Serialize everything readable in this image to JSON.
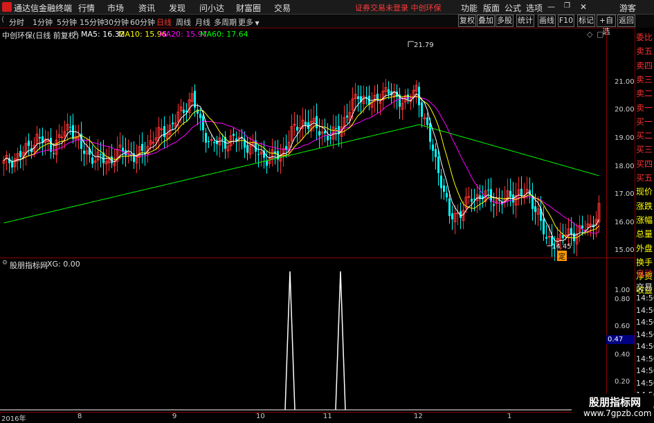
{
  "app": {
    "name": "通达信金融终端",
    "notice": "证券交易未登录",
    "stock_short": "中创环保"
  },
  "menu": [
    "行情",
    "市场",
    "资讯",
    "发现",
    "问小达",
    "财富圈",
    "交易"
  ],
  "right_menu": [
    "功能",
    "版面",
    "公式",
    "选项",
    "游客"
  ],
  "timeframes": [
    "分时",
    "1分钟",
    "5分钟",
    "15分钟",
    "30分钟",
    "60分钟",
    "日线",
    "周线",
    "月线",
    "多周期",
    "更多"
  ],
  "active_timeframe": "日线",
  "toolbar": [
    "复权",
    "叠加",
    "多股",
    "统计",
    "画线",
    "F10",
    "标记",
    "+自选",
    "返回"
  ],
  "legend": {
    "title": "中创环保(日线 前复权)",
    "ma5": "MA5: 16.32",
    "ma10": "MA10: 15.96",
    "ma20": "MA20: 15.97",
    "ma60": "MA60: 17.64"
  },
  "colors": {
    "ma5": "#ffffff",
    "ma10": "#ffff00",
    "ma20": "#ff00ff",
    "ma60": "#00ff00",
    "up": "#ff3232",
    "down": "#00ffff",
    "label_red": "#ff3030",
    "label_yellow": "#ffff00"
  },
  "price_axis": [
    "21.00",
    "20.00",
    "19.00",
    "18.00",
    "17.00",
    "16.00",
    "15.00"
  ],
  "annotations": {
    "high": "21.79",
    "low": "14.45",
    "low_tag": "定"
  },
  "indicator": {
    "title": "股朋指标网",
    "xg": "XG: 0.00",
    "axis": [
      "1.00",
      "0.80",
      "0.60",
      "0.40",
      "0.20"
    ],
    "value_box": "0.47"
  },
  "date_axis": [
    "2016年",
    "8",
    "9",
    "10",
    "11",
    "12",
    "1"
  ],
  "right_panel_red": [
    "委比",
    "卖五",
    "卖四",
    "卖三",
    "卖二",
    "卖一",
    "买一",
    "买二",
    "买三",
    "买四",
    "买五"
  ],
  "right_panel_yellow": [
    "现价",
    "涨跌",
    "涨幅",
    "总量",
    "外盘",
    "换手",
    "净资",
    "收益"
  ],
  "right_panel_red2": [
    "自动"
  ],
  "right_panel_white": [
    "交易"
  ],
  "right_panel_times": [
    "14:56",
    "14:56",
    "14:56",
    "14:56",
    "14:56",
    "14:56",
    "14:56",
    "14:56",
    "14:56",
    "14:56"
  ],
  "watermark": {
    "line1": "股朋指标网",
    "line2": "www.7gpzb.com"
  }
}
